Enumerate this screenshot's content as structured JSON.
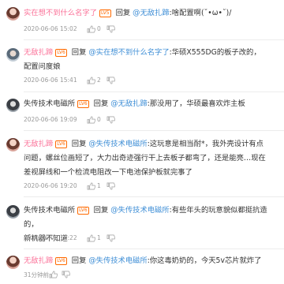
{
  "comments": [
    {
      "user": "实在想不到什么名字了",
      "level": "LV5",
      "reply_word": "回复",
      "mention": "@无敌扎蹄",
      "text_line1": ":啥配置啊(˘•ω•˘)/",
      "text_line2": "",
      "time": "2020-06-06 15:02",
      "likes": "0"
    },
    {
      "user": "无敌扎蹄",
      "level": "LV6",
      "reply_word": "回复",
      "mention": "@实在想不到什么名字了",
      "text_line1": ":华硕X555DG的板子改的，",
      "text_line2": "配置问度娘",
      "time": "2020-06-06 15:41",
      "likes": "2"
    },
    {
      "user": "失传技术电磁所",
      "level": "LV6",
      "reply_word": "回复",
      "mention": "@无敌扎蹄",
      "text_line1": ":那没用了，华硕最喜欢炸主板",
      "text_line2": "",
      "time": "2020-06-06 19:09",
      "likes": "0"
    },
    {
      "user": "无敌扎蹄",
      "level": "LV6",
      "reply_word": "回复",
      "mention": "@失传技术电磁所",
      "text_line1": ":这玩意是相当耐*，我外壳设计有点",
      "text_line2": "问题，螺丝位画短了，大力出奇迹强行干上去板子都弯了，还是能亮…现在",
      "text_line3": "差视屏线和一个检流电阻改一下电池保护板就完事了",
      "time": "2020-06-06 19:20",
      "likes": "1"
    },
    {
      "user": "失传技术电磁所",
      "level": "LV6",
      "reply_word": "回复",
      "mention": "@失传技术电磁所",
      "text_line1": ":有些年头的玩意貌似都挺抗造的，",
      "text_line2": "新机器不知道",
      "time": "2020-06-06 19:22",
      "likes": "1"
    },
    {
      "user": "无敌扎蹄",
      "level": "LV6",
      "reply_word": "回复",
      "mention": "@失传技术电磁所",
      "text_line1": ":你这毒奶奶的，今天5v芯片就炸了",
      "text_line2": "",
      "time": "31分钟前",
      "likes": ""
    }
  ],
  "colors": {
    "username": "#fb7299",
    "mention": "#3e8ed6",
    "level_badge": "#ff6a00",
    "meta": "#999999"
  },
  "icons": {
    "like": "thumb-up-icon",
    "dislike": "thumb-down-icon"
  }
}
